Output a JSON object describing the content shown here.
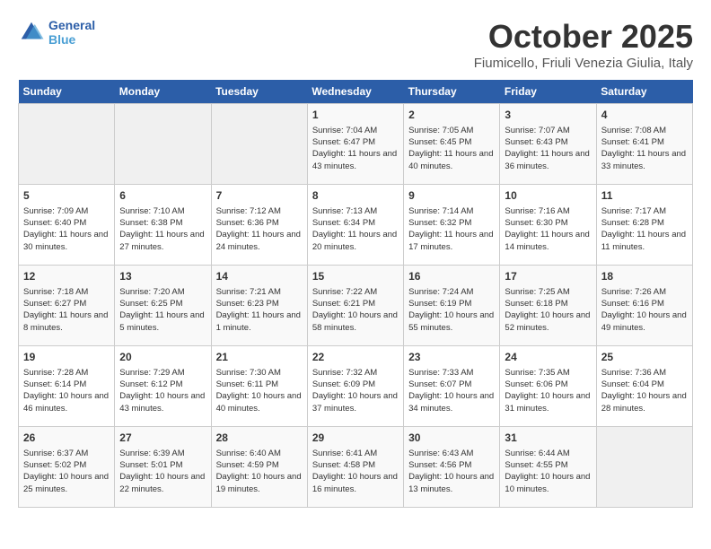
{
  "header": {
    "logo_line1": "General",
    "logo_line2": "Blue",
    "month_title": "October 2025",
    "location": "Fiumicello, Friuli Venezia Giulia, Italy"
  },
  "weekdays": [
    "Sunday",
    "Monday",
    "Tuesday",
    "Wednesday",
    "Thursday",
    "Friday",
    "Saturday"
  ],
  "weeks": [
    [
      {
        "day": "",
        "info": ""
      },
      {
        "day": "",
        "info": ""
      },
      {
        "day": "",
        "info": ""
      },
      {
        "day": "1",
        "info": "Sunrise: 7:04 AM\nSunset: 6:47 PM\nDaylight: 11 hours and 43 minutes."
      },
      {
        "day": "2",
        "info": "Sunrise: 7:05 AM\nSunset: 6:45 PM\nDaylight: 11 hours and 40 minutes."
      },
      {
        "day": "3",
        "info": "Sunrise: 7:07 AM\nSunset: 6:43 PM\nDaylight: 11 hours and 36 minutes."
      },
      {
        "day": "4",
        "info": "Sunrise: 7:08 AM\nSunset: 6:41 PM\nDaylight: 11 hours and 33 minutes."
      }
    ],
    [
      {
        "day": "5",
        "info": "Sunrise: 7:09 AM\nSunset: 6:40 PM\nDaylight: 11 hours and 30 minutes."
      },
      {
        "day": "6",
        "info": "Sunrise: 7:10 AM\nSunset: 6:38 PM\nDaylight: 11 hours and 27 minutes."
      },
      {
        "day": "7",
        "info": "Sunrise: 7:12 AM\nSunset: 6:36 PM\nDaylight: 11 hours and 24 minutes."
      },
      {
        "day": "8",
        "info": "Sunrise: 7:13 AM\nSunset: 6:34 PM\nDaylight: 11 hours and 20 minutes."
      },
      {
        "day": "9",
        "info": "Sunrise: 7:14 AM\nSunset: 6:32 PM\nDaylight: 11 hours and 17 minutes."
      },
      {
        "day": "10",
        "info": "Sunrise: 7:16 AM\nSunset: 6:30 PM\nDaylight: 11 hours and 14 minutes."
      },
      {
        "day": "11",
        "info": "Sunrise: 7:17 AM\nSunset: 6:28 PM\nDaylight: 11 hours and 11 minutes."
      }
    ],
    [
      {
        "day": "12",
        "info": "Sunrise: 7:18 AM\nSunset: 6:27 PM\nDaylight: 11 hours and 8 minutes."
      },
      {
        "day": "13",
        "info": "Sunrise: 7:20 AM\nSunset: 6:25 PM\nDaylight: 11 hours and 5 minutes."
      },
      {
        "day": "14",
        "info": "Sunrise: 7:21 AM\nSunset: 6:23 PM\nDaylight: 11 hours and 1 minute."
      },
      {
        "day": "15",
        "info": "Sunrise: 7:22 AM\nSunset: 6:21 PM\nDaylight: 10 hours and 58 minutes."
      },
      {
        "day": "16",
        "info": "Sunrise: 7:24 AM\nSunset: 6:19 PM\nDaylight: 10 hours and 55 minutes."
      },
      {
        "day": "17",
        "info": "Sunrise: 7:25 AM\nSunset: 6:18 PM\nDaylight: 10 hours and 52 minutes."
      },
      {
        "day": "18",
        "info": "Sunrise: 7:26 AM\nSunset: 6:16 PM\nDaylight: 10 hours and 49 minutes."
      }
    ],
    [
      {
        "day": "19",
        "info": "Sunrise: 7:28 AM\nSunset: 6:14 PM\nDaylight: 10 hours and 46 minutes."
      },
      {
        "day": "20",
        "info": "Sunrise: 7:29 AM\nSunset: 6:12 PM\nDaylight: 10 hours and 43 minutes."
      },
      {
        "day": "21",
        "info": "Sunrise: 7:30 AM\nSunset: 6:11 PM\nDaylight: 10 hours and 40 minutes."
      },
      {
        "day": "22",
        "info": "Sunrise: 7:32 AM\nSunset: 6:09 PM\nDaylight: 10 hours and 37 minutes."
      },
      {
        "day": "23",
        "info": "Sunrise: 7:33 AM\nSunset: 6:07 PM\nDaylight: 10 hours and 34 minutes."
      },
      {
        "day": "24",
        "info": "Sunrise: 7:35 AM\nSunset: 6:06 PM\nDaylight: 10 hours and 31 minutes."
      },
      {
        "day": "25",
        "info": "Sunrise: 7:36 AM\nSunset: 6:04 PM\nDaylight: 10 hours and 28 minutes."
      }
    ],
    [
      {
        "day": "26",
        "info": "Sunrise: 6:37 AM\nSunset: 5:02 PM\nDaylight: 10 hours and 25 minutes."
      },
      {
        "day": "27",
        "info": "Sunrise: 6:39 AM\nSunset: 5:01 PM\nDaylight: 10 hours and 22 minutes."
      },
      {
        "day": "28",
        "info": "Sunrise: 6:40 AM\nSunset: 4:59 PM\nDaylight: 10 hours and 19 minutes."
      },
      {
        "day": "29",
        "info": "Sunrise: 6:41 AM\nSunset: 4:58 PM\nDaylight: 10 hours and 16 minutes."
      },
      {
        "day": "30",
        "info": "Sunrise: 6:43 AM\nSunset: 4:56 PM\nDaylight: 10 hours and 13 minutes."
      },
      {
        "day": "31",
        "info": "Sunrise: 6:44 AM\nSunset: 4:55 PM\nDaylight: 10 hours and 10 minutes."
      },
      {
        "day": "",
        "info": ""
      }
    ]
  ]
}
